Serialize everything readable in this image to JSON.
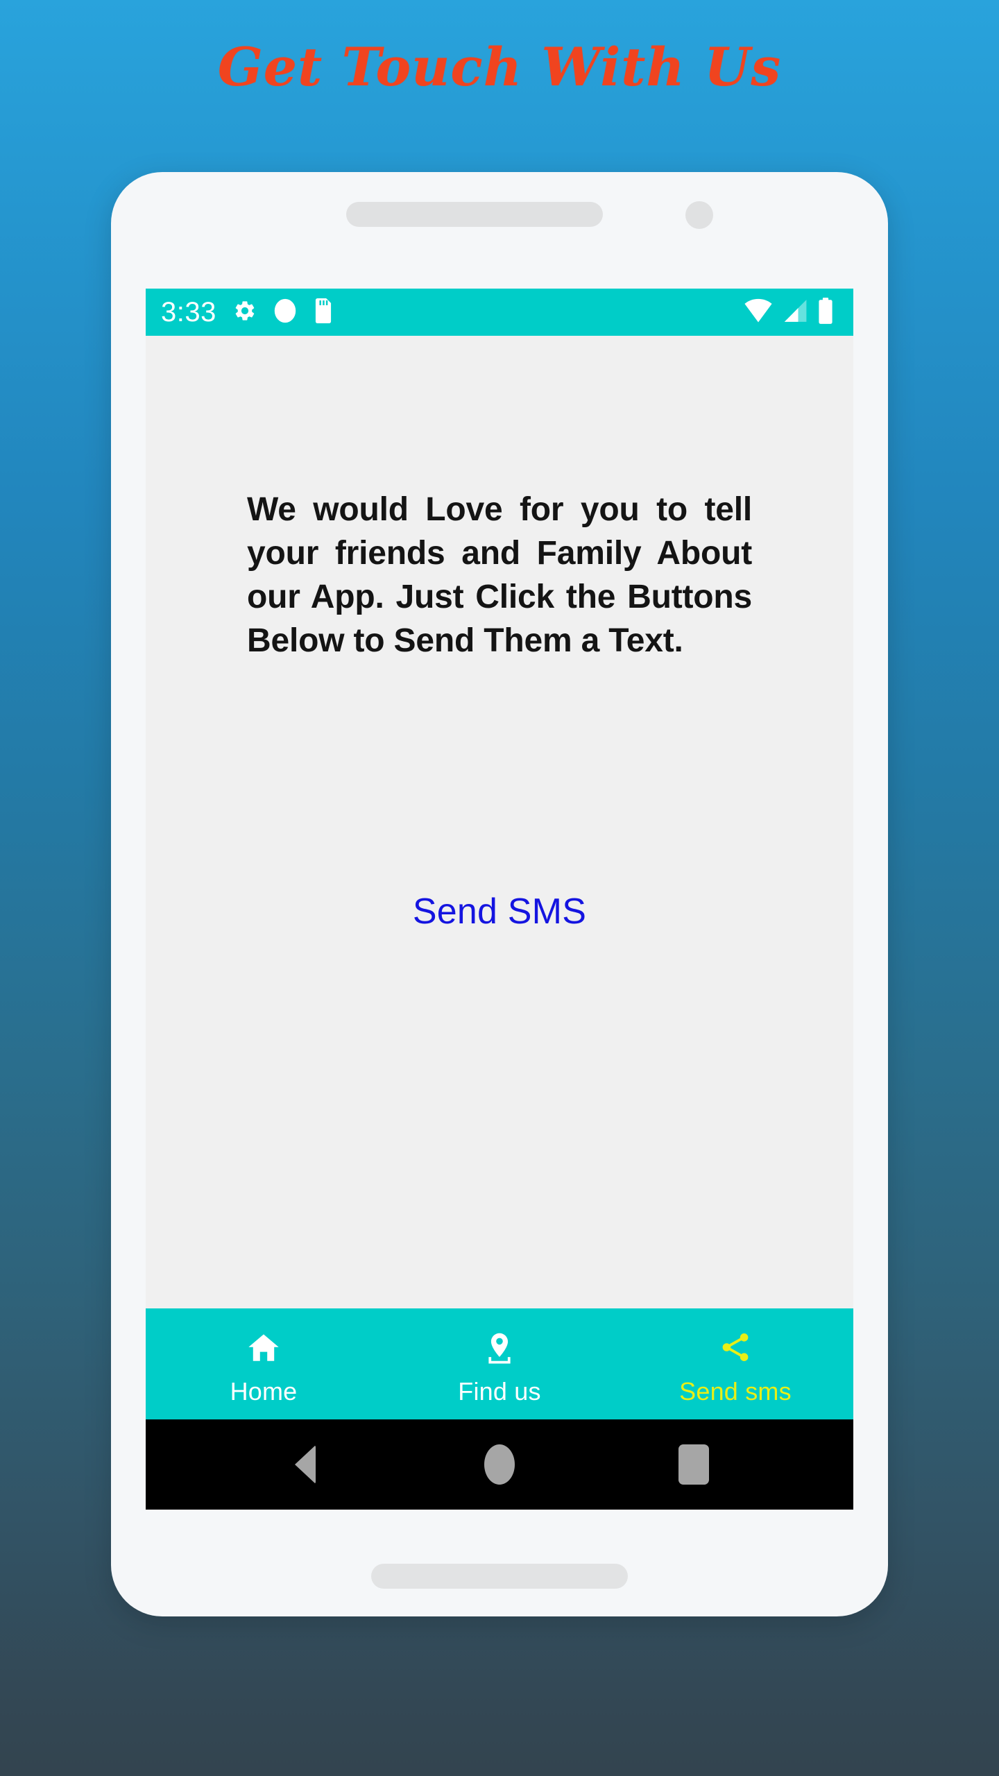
{
  "page": {
    "heading": "Get Touch With Us",
    "heading_color": "#f0441f",
    "background_gradient_from": "#29a3dc",
    "background_gradient_to": "#33444f"
  },
  "device": {
    "frame_color": "#f5f7f9",
    "screen_background": "#f0f0f0",
    "accent_color": "#00cdc8",
    "parts": {
      "earpiece_speaker": "speaker-grille",
      "front_camera": "camera-lens",
      "bottom_speaker": "speaker-grille"
    }
  },
  "status_bar": {
    "background": "#00cdc8",
    "time": "3:33",
    "left_icons": [
      "gear-icon",
      "circle-icon",
      "sd-card-icon"
    ],
    "right_icons": [
      "wifi-icon",
      "cell-signal-icon",
      "battery-icon"
    ]
  },
  "main": {
    "promo_text": "We would Love for you to tell your friends and Family About our App. Just Click the Buttons Below to Send Them a Text.",
    "promo_text_color": "#141414",
    "send_sms_link": "Send SMS",
    "send_sms_color": "#1414e0"
  },
  "bottom_nav": {
    "background": "#00cdc8",
    "active_color": "#e8ef17",
    "inactive_color": "#ffffff",
    "items": [
      {
        "label": "Home",
        "icon": "home-icon",
        "active": false
      },
      {
        "label": "Find us",
        "icon": "location-pin-icon",
        "active": false
      },
      {
        "label": "Send sms",
        "icon": "share-icon",
        "active": true
      }
    ]
  },
  "android_nav": {
    "background": "#000000",
    "key_color": "#a6a6a6",
    "keys": [
      "back-key",
      "home-key",
      "recents-key"
    ]
  }
}
